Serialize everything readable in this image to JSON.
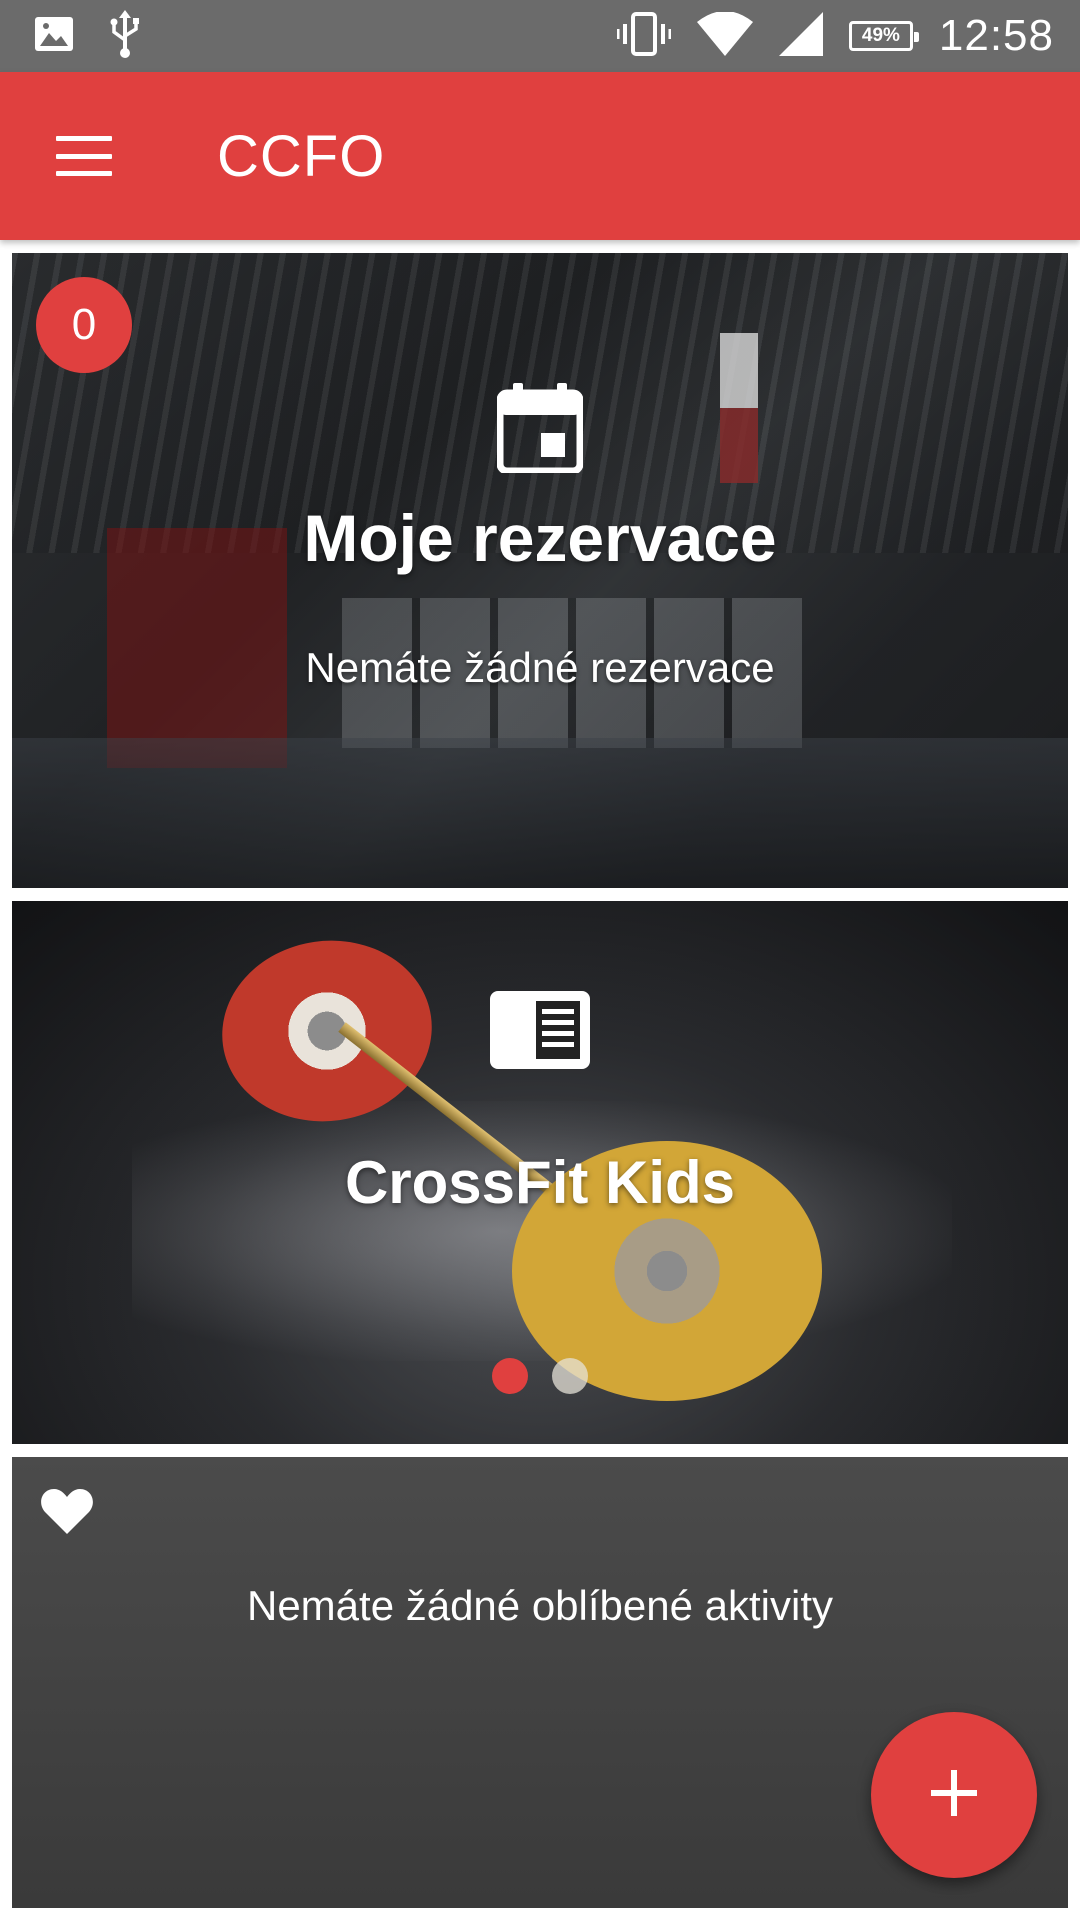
{
  "status_bar": {
    "icons": [
      "image-icon",
      "usb-icon",
      "vibrate-icon",
      "wifi-icon",
      "signal-icon",
      "battery-icon"
    ],
    "battery": "49%",
    "time": "12:58"
  },
  "app_bar": {
    "title": "CCFO",
    "color": "#e0403f"
  },
  "reservations_card": {
    "count": "0",
    "icon": "calendar-icon",
    "title": "Moje rezervace",
    "subtitle": "Nemáte žádné rezervace"
  },
  "news_card": {
    "icon": "news-icon",
    "title": "CrossFit Kids",
    "pages": 2,
    "active_page": 1
  },
  "favorites_card": {
    "icon": "heart-icon",
    "empty_text": "Nemáte žádné oblíbené aktivity"
  },
  "fab": {
    "icon": "plus-icon"
  }
}
